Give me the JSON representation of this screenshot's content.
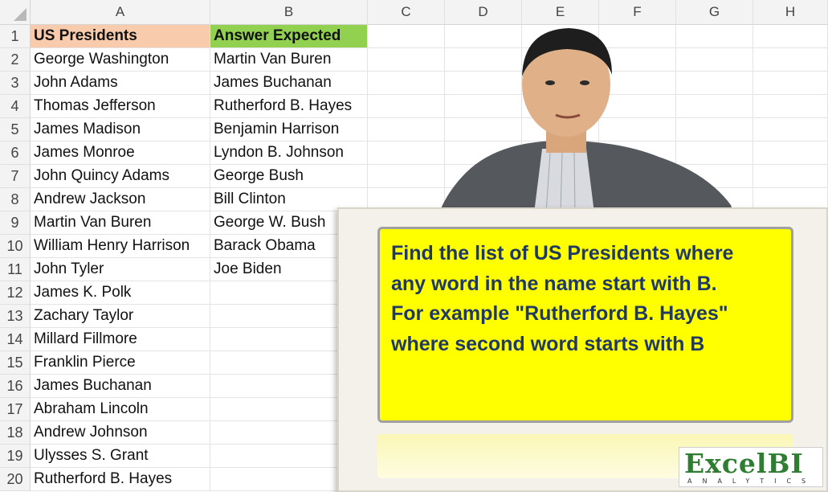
{
  "columns": [
    "A",
    "B",
    "C",
    "D",
    "E",
    "F",
    "G",
    "H"
  ],
  "rows": [
    "1",
    "2",
    "3",
    "4",
    "5",
    "6",
    "7",
    "8",
    "9",
    "10",
    "11",
    "12",
    "13",
    "14",
    "15",
    "16",
    "17",
    "18",
    "19",
    "20"
  ],
  "colA": [
    "US Presidents",
    "George Washington",
    "John Adams",
    "Thomas Jefferson",
    "James Madison",
    "James Monroe",
    "John Quincy Adams",
    "Andrew Jackson",
    "Martin Van Buren",
    "William Henry Harrison",
    "John Tyler",
    "James K. Polk",
    "Zachary Taylor",
    "Millard Fillmore",
    "Franklin Pierce",
    "James Buchanan",
    "Abraham Lincoln",
    "Andrew Johnson",
    "Ulysses S. Grant",
    "Rutherford B. Hayes"
  ],
  "colB": [
    "Answer Expected",
    "Martin Van Buren",
    "James Buchanan",
    "Rutherford B. Hayes",
    "Benjamin Harrison",
    "Lyndon B. Johnson",
    "George Bush",
    "Bill Clinton",
    "George W. Bush",
    "Barack Obama",
    "Joe Biden"
  ],
  "board": {
    "lines": [
      "Find the list of US Presidents where",
      "any word in the name start with B.",
      "For example \"Rutherford B. Hayes\"",
      "where second word starts with B"
    ]
  },
  "logo": {
    "main": "Excel",
    "accent": "BI",
    "sub": "ANALYTICS"
  },
  "colors": {
    "headerA": "#f8cbad",
    "headerB": "#92d050",
    "note": "#ffff00",
    "noteText": "#1f3864"
  }
}
